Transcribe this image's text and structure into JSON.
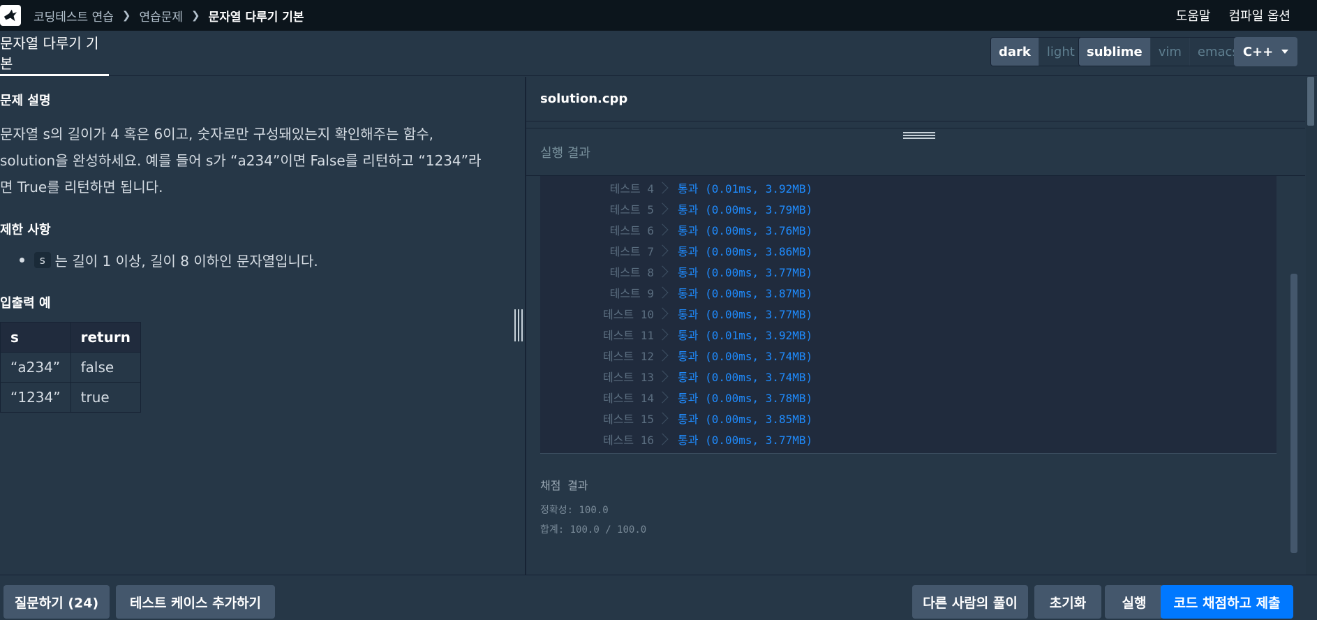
{
  "nav": {
    "breadcrumbs": [
      "코딩테스트 연습",
      "연습문제",
      "문자열 다루기 기본"
    ],
    "help": "도움말",
    "compile_options": "컴파일 옵션"
  },
  "header": {
    "problem_tab": "문자열 다루기 기본",
    "theme_options": [
      "dark",
      "light"
    ],
    "theme_selected": "dark",
    "keymap_options": [
      "sublime",
      "vim",
      "emacs"
    ],
    "keymap_selected": "sublime",
    "language": "C++"
  },
  "problem": {
    "description_title": "문제 설명",
    "description": "문자열 s의 길이가 4 혹은 6이고, 숫자로만 구성돼있는지 확인해주는 함수, solution을 완성하세요. 예를 들어 s가 “a234”이면 False를 리턴하고 “1234”라면 True를 리턴하면 됩니다.",
    "constraints_title": "제한 사항",
    "constraint_code": "s",
    "constraint_text": "는 길이 1 이상, 길이 8 이하인 문자열입니다.",
    "io_title": "입출력 예",
    "io_headers": [
      "s",
      "return"
    ],
    "io_rows": [
      [
        "“a234”",
        "false"
      ],
      [
        "“1234”",
        "true"
      ]
    ]
  },
  "editor": {
    "filename": "solution.cpp",
    "result_title": "실행 결과"
  },
  "tests": [
    {
      "label": "테스트 4",
      "result": "통과 (0.01ms, 3.92MB)"
    },
    {
      "label": "테스트 5",
      "result": "통과 (0.00ms, 3.79MB)"
    },
    {
      "label": "테스트 6",
      "result": "통과 (0.00ms, 3.76MB)"
    },
    {
      "label": "테스트 7",
      "result": "통과 (0.00ms, 3.86MB)"
    },
    {
      "label": "테스트 8",
      "result": "통과 (0.00ms, 3.77MB)"
    },
    {
      "label": "테스트 9",
      "result": "통과 (0.00ms, 3.87MB)"
    },
    {
      "label": "테스트 10",
      "result": "통과 (0.00ms, 3.77MB)"
    },
    {
      "label": "테스트 11",
      "result": "통과 (0.01ms, 3.92MB)"
    },
    {
      "label": "테스트 12",
      "result": "통과 (0.00ms, 3.74MB)"
    },
    {
      "label": "테스트 13",
      "result": "통과 (0.00ms, 3.74MB)"
    },
    {
      "label": "테스트 14",
      "result": "통과 (0.00ms, 3.78MB)"
    },
    {
      "label": "테스트 15",
      "result": "통과 (0.00ms, 3.85MB)"
    },
    {
      "label": "테스트 16",
      "result": "통과 (0.00ms, 3.77MB)"
    }
  ],
  "grading": {
    "title": "채점 결과",
    "accuracy": "정확성: 100.0",
    "total": "합계: 100.0 / 100.0"
  },
  "footer": {
    "ask": "질문하기 (24)",
    "add_testcase": "테스트 케이스 추가하기",
    "others_solutions": "다른 사람의 풀이",
    "reset": "초기화",
    "run": "실행",
    "submit": "코드 채점하고 제출"
  },
  "colors": {
    "accent": "#0078ff",
    "pass": "#1f8cff",
    "panel": "#263747",
    "nav": "#0c151c"
  }
}
